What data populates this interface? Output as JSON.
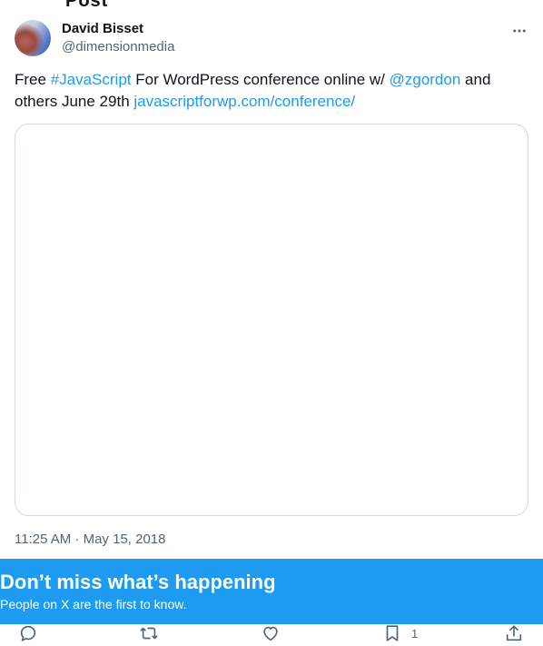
{
  "page": {
    "partial_title": "Post"
  },
  "author": {
    "name": "David Bisset",
    "handle": "@dimensionmedia"
  },
  "tweet": {
    "prefix": "Free ",
    "hashtag": "#JavaScript",
    "middle": " For WordPress conference online w/ ",
    "mention": "@zgordon",
    "suffix": " and others June 29th ",
    "url": "javascriptforwp.com/conference/"
  },
  "timestamp": "11:25 AM · May 15, 2018",
  "banner": {
    "title": "Don’t miss what’s happening",
    "subtitle": "People on X are the first to know."
  },
  "actions": {
    "reply_icon": "reply-icon",
    "retweet_icon": "retweet-icon",
    "like_icon": "heart-icon",
    "bookmark_icon": "bookmark-icon",
    "bookmark_count": "1",
    "share_icon": "share-icon"
  },
  "colors": {
    "accent": "#1d9bf0",
    "text": "#0f1419",
    "muted": "#536471",
    "border": "#cfd9de"
  }
}
